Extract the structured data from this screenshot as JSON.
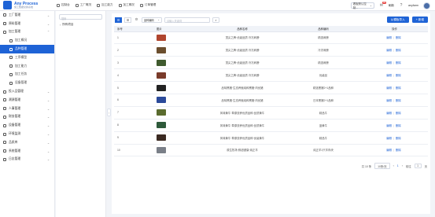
{
  "header": {
    "logo_title": "Any Process",
    "logo_subtitle": "施工数据交换系统",
    "nav": [
      "控制台",
      "工厂概况",
      "加工能力",
      "加工概况",
      "订单管理"
    ],
    "project_select": "看板默认控制...",
    "message_badge": "99",
    "refresh_label": "刷新",
    "user_name": "anyfarm"
  },
  "sidebar": {
    "items": [
      {
        "label": "工厂管理",
        "chev": "⌄"
      },
      {
        "label": "原料管理",
        "chev": "⌄"
      },
      {
        "label": "加工管理",
        "chev": "⌃"
      },
      {
        "label": "加工概况",
        "sub": true
      },
      {
        "label": "品种管理",
        "sub": true,
        "active": true
      },
      {
        "label": "工序模型",
        "sub": true
      },
      {
        "label": "加工能力",
        "sub": true
      },
      {
        "label": "加工任务",
        "sub": true
      },
      {
        "label": "设备管理",
        "sub": true
      },
      {
        "label": "投入品管理",
        "chev": "⌄"
      },
      {
        "label": "溯源管理",
        "chev": "⌄"
      },
      {
        "label": "人事管理",
        "chev": "⌄"
      },
      {
        "label": "财务管理",
        "chev": "⌄"
      },
      {
        "label": "设备管理",
        "chev": "⌄"
      },
      {
        "label": "环境监测",
        "chev": "⌄"
      },
      {
        "label": "品质库",
        "chev": "⌄"
      },
      {
        "label": "系统管理",
        "chev": "⌄"
      },
      {
        "label": "日志管理",
        "chev": "⌄"
      }
    ]
  },
  "tree": {
    "search_placeholder": "搜索",
    "root_label": "所有项目"
  },
  "toolbar": {
    "field_select": "品种编码",
    "search_placeholder": "请输入关键词",
    "import_label": "从模板导入",
    "add_label": "+ 新增"
  },
  "table": {
    "columns": [
      "序号",
      "图片",
      "品种名称",
      "品种编码",
      "操作"
    ],
    "rows": [
      {
        "no": "1",
        "name": "顶尖之牌·优级品质·冷冻肩膀",
        "code": "精选肩膀",
        "color": "#b0452e"
      },
      {
        "no": "2",
        "name": "顶尖之牌·优级品质·冷冻肩膀",
        "code": "冷冻肩膀",
        "color": "#6b4e2e"
      },
      {
        "no": "3",
        "name": "顶尖之牌·优级品质·冷冻肩膀",
        "code": "精选肩膀",
        "color": "#3f5a2e"
      },
      {
        "no": "4",
        "name": "顶尖之牌·优级品质·冷冻肩膀",
        "code": "优级品",
        "color": "#7a3b2a"
      },
      {
        "no": "5",
        "name": "品味黑猪·生态养殖纯种黑猪·肉优猪",
        "code": "精选黑猪2+1品种",
        "color": "#222222"
      },
      {
        "no": "6",
        "name": "品味黑猪·生态养殖纯种黑猪·肉优猪",
        "code": "日本黑猪2+1品种",
        "color": "#2b4a9a"
      },
      {
        "no": "7",
        "name": "风味黄牛·草原放养优质品种·品质黄牛",
        "code": "精品牛",
        "color": "#5a6b2e"
      },
      {
        "no": "8",
        "name": "风味黄牛·草原放养优质品种·品质黄牛",
        "code": "蓝黄牛",
        "color": "#2e5a3a"
      },
      {
        "no": "9",
        "name": "风味黄牛·草原放养优质品种·优级黄牛",
        "code": "精品牛",
        "color": "#3b2a22"
      },
      {
        "no": "10",
        "name": "原生牧场·鲜甜健康·纯正羊",
        "code": "纯正羊1只羊肉块",
        "color": "#7a7f88"
      }
    ],
    "edit_label": "编辑",
    "delete_label": "删除"
  },
  "pager": {
    "total": "共 10 条",
    "page_size": "10条/页",
    "prev": "‹",
    "page": "1",
    "next": "›",
    "goto": "前往",
    "goto_value": "1",
    "page_unit": "页"
  }
}
